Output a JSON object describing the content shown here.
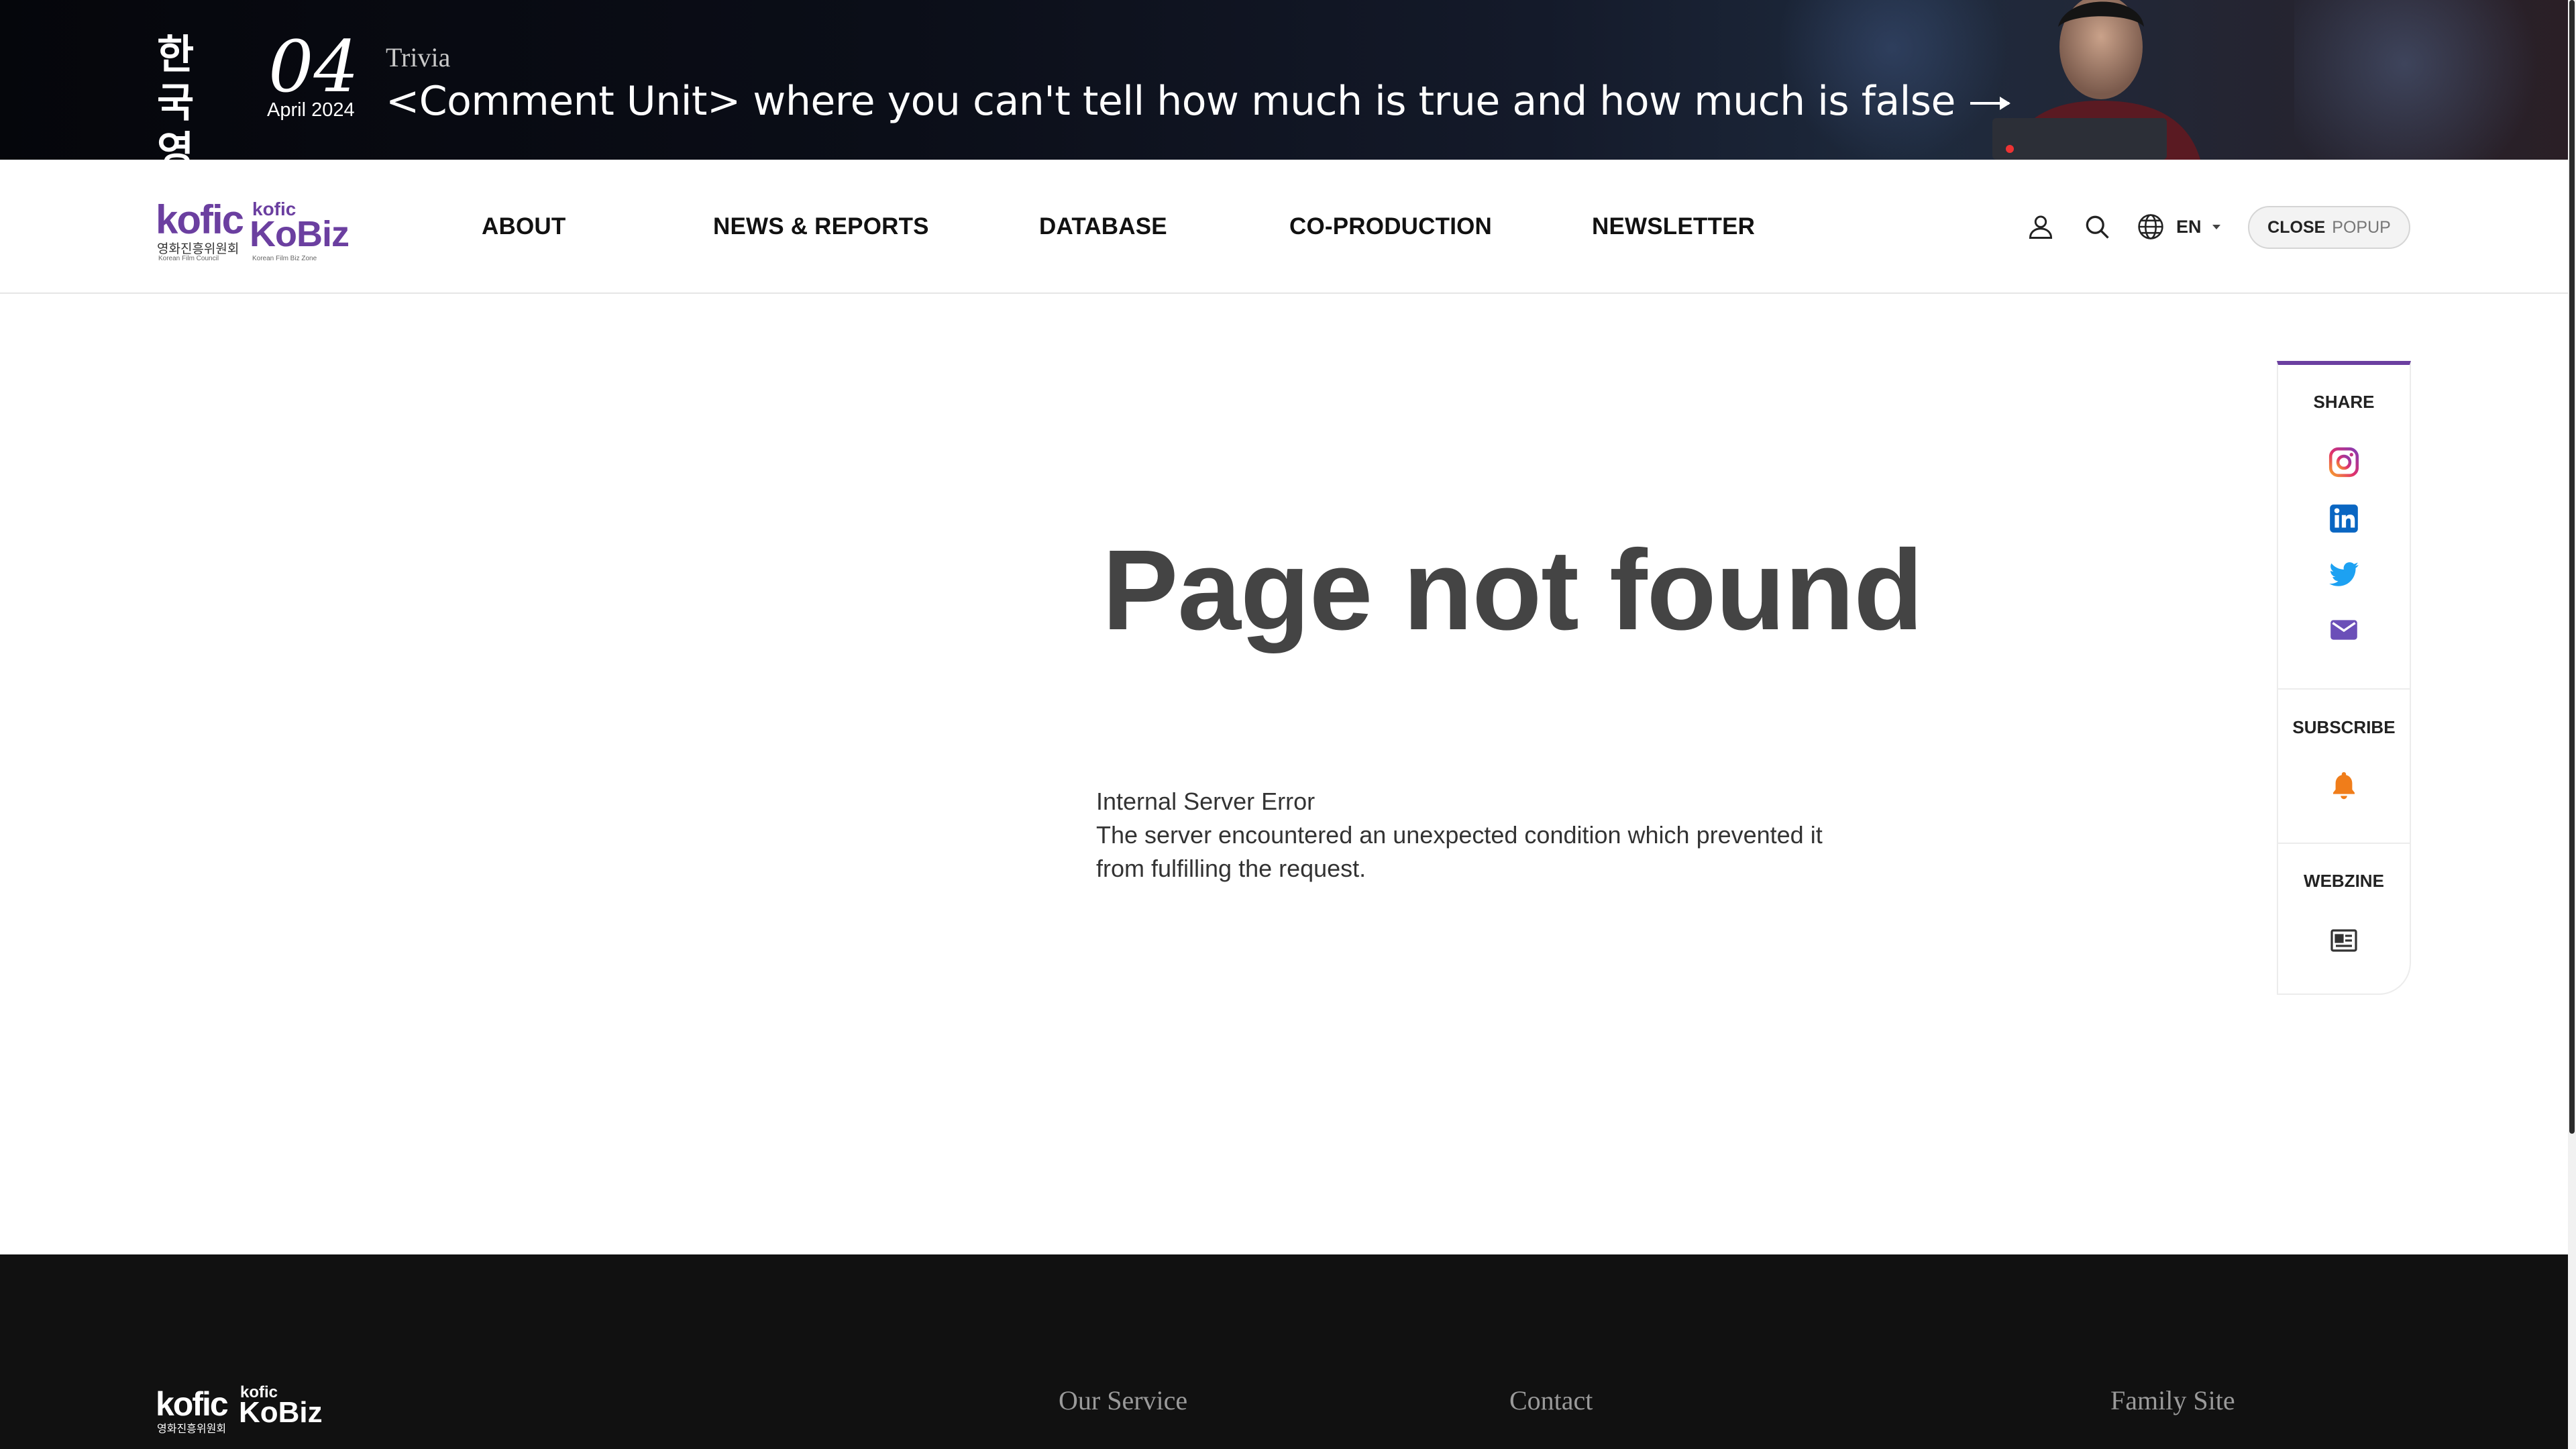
{
  "banner": {
    "brand_kr": "한국 영화",
    "issue_number": "04",
    "issue_date": "April 2024",
    "category": "Trivia",
    "headline": "<Comment Unit> where you can't tell how much is true and how much is false"
  },
  "header": {
    "logo": {
      "kofic": "kofic",
      "kofic_kr": "영화진흥위원회",
      "kofic_en": "Korean Film Council",
      "kobiz_small": "kofic",
      "kobiz": "KoBiz",
      "kobiz_en": "Korean Film Biz Zone"
    },
    "nav": {
      "about": "ABOUT",
      "news": "NEWS & REPORTS",
      "database": "DATABASE",
      "coproduction": "CO-PRODUCTION",
      "newsletter": "NEWSLETTER"
    },
    "lang": "EN",
    "popup_close": "CLOSE",
    "popup_label": "POPUP"
  },
  "main": {
    "title": "Page not found",
    "error_heading": "Internal Server Error",
    "error_message": "The server encountered an unexpected condition which prevented it from fulfilling the request."
  },
  "side": {
    "share_label": "SHARE",
    "subscribe_label": "SUBSCRIBE",
    "webzine_label": "WEBZINE",
    "icons": [
      "instagram-icon",
      "linkedin-icon",
      "twitter-icon",
      "mail-icon",
      "bell-icon",
      "newspaper-icon"
    ]
  },
  "footer": {
    "logo": {
      "kofic": "kofic",
      "kofic_kr": "영화진흥위원회",
      "kobiz_small": "kofic",
      "kobiz": "KoBiz"
    },
    "our_service": "Our Service",
    "contact": "Contact",
    "family_site": "Family Site"
  },
  "colors": {
    "accent": "#6b3fa0",
    "banner_bg": "#0b0e18",
    "footer_bg": "#111111",
    "bell": "#f07d1a",
    "twitter": "#1da1f2",
    "linkedin": "#0a66c2"
  }
}
